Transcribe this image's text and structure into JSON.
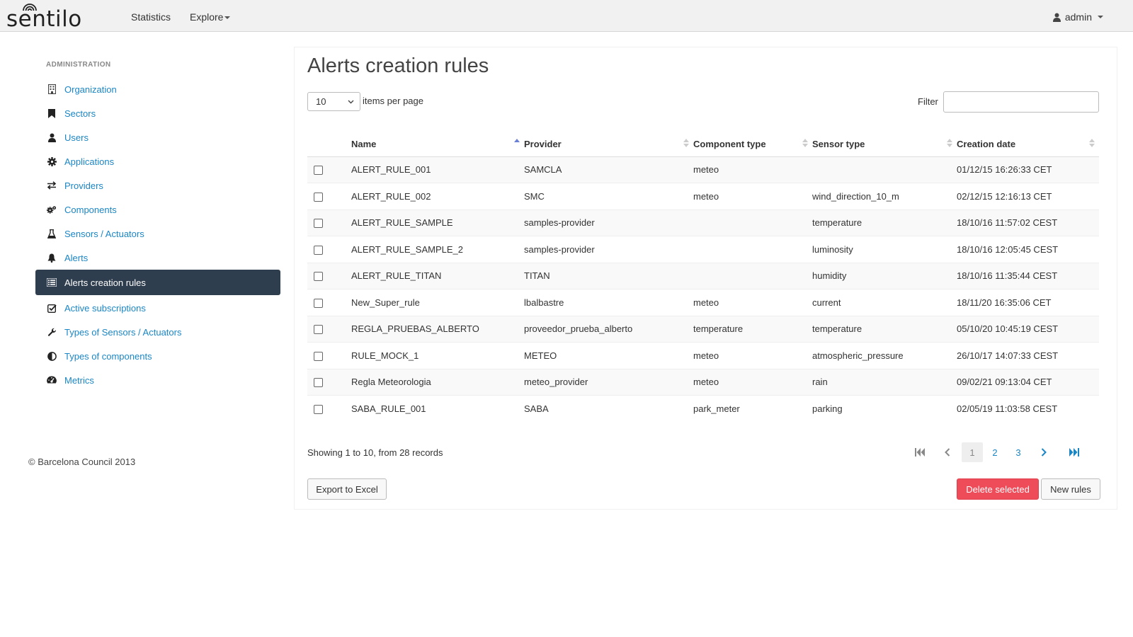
{
  "brand": {
    "name": "sentilo"
  },
  "nav": {
    "statistics": "Statistics",
    "explore": "Explore",
    "user": "admin"
  },
  "sidebar": {
    "title": "ADMINISTRATION",
    "items": [
      {
        "label": "Organization",
        "icon": "building-icon"
      },
      {
        "label": "Sectors",
        "icon": "bookmark-icon"
      },
      {
        "label": "Users",
        "icon": "user-icon"
      },
      {
        "label": "Applications",
        "icon": "gear-icon"
      },
      {
        "label": "Providers",
        "icon": "exchange-icon"
      },
      {
        "label": "Components",
        "icon": "gears-icon"
      },
      {
        "label": "Sensors / Actuators",
        "icon": "flask-icon"
      },
      {
        "label": "Alerts",
        "icon": "bell-icon"
      },
      {
        "label": "Alerts creation rules",
        "icon": "list-icon",
        "active": true
      },
      {
        "label": "Active subscriptions",
        "icon": "check-square-icon"
      },
      {
        "label": "Types of Sensors / Actuators",
        "icon": "wrench-icon"
      },
      {
        "label": "Types of components",
        "icon": "half-circle-icon"
      },
      {
        "label": "Metrics",
        "icon": "dashboard-icon"
      }
    ]
  },
  "footer": "© Barcelona Council 2013",
  "main": {
    "title": "Alerts creation rules",
    "per_page_value": "10",
    "per_page_label": "items per page",
    "filter_label": "Filter",
    "filter_value": "",
    "columns": [
      "Name",
      "Provider",
      "Component type",
      "Sensor type",
      "Creation date"
    ],
    "rows": [
      [
        "ALERT_RULE_001",
        "SAMCLA",
        "meteo",
        "",
        "01/12/15 16:26:33 CET"
      ],
      [
        "ALERT_RULE_002",
        "SMC",
        "meteo",
        "wind_direction_10_m",
        "02/12/15 12:16:13 CET"
      ],
      [
        "ALERT_RULE_SAMPLE",
        "samples-provider",
        "",
        "temperature",
        "18/10/16 11:57:02 CEST"
      ],
      [
        "ALERT_RULE_SAMPLE_2",
        "samples-provider",
        "",
        "luminosity",
        "18/10/16 12:05:45 CEST"
      ],
      [
        "ALERT_RULE_TITAN",
        "TITAN",
        "",
        "humidity",
        "18/10/16 11:35:44 CEST"
      ],
      [
        "New_Super_rule",
        "lbalbastre",
        "meteo",
        "current",
        "18/11/20 16:35:06 CET"
      ],
      [
        "REGLA_PRUEBAS_ALBERTO",
        "proveedor_prueba_alberto",
        "temperature",
        "temperature",
        "05/10/20 10:45:19 CEST"
      ],
      [
        "RULE_MOCK_1",
        "METEO",
        "meteo",
        "atmospheric_pressure",
        "26/10/17 14:07:33 CEST"
      ],
      [
        "Regla Meteorologia",
        "meteo_provider",
        "meteo",
        "rain",
        "09/02/21 09:13:04 CET"
      ],
      [
        "SABA_RULE_001",
        "SABA",
        "park_meter",
        "parking",
        "02/05/19 11:03:58 CEST"
      ]
    ],
    "showing": "Showing 1 to 10, from 28 records",
    "pages": [
      "1",
      "2",
      "3"
    ],
    "export_label": "Export to Excel",
    "delete_label": "Delete selected",
    "new_label": "New rules"
  },
  "colors": {
    "accent": "#1a86c5",
    "sidebar_active": "#2f3e4e",
    "danger": "#ef4c5a",
    "sort_active": "#6a7fd6"
  }
}
